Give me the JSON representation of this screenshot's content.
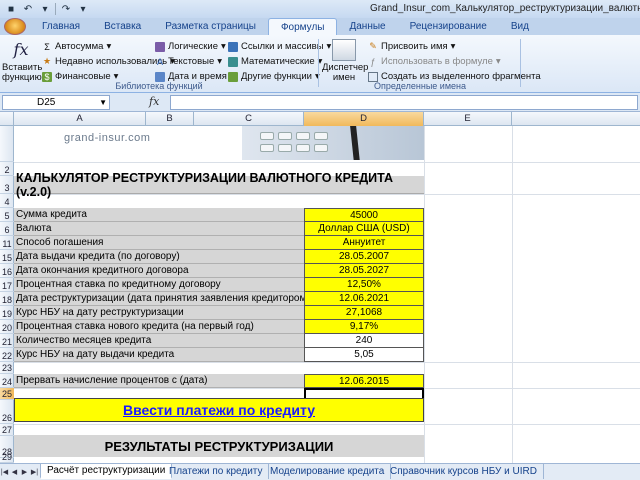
{
  "window": {
    "title": "Grand_Insur_com_Калькулятор_реструктуризации_валютного"
  },
  "ribbon_tabs": [
    "Главная",
    "Вставка",
    "Разметка страницы",
    "Формулы",
    "Данные",
    "Рецензирование",
    "Вид"
  ],
  "active_tab": "Формулы",
  "ribbon": {
    "insert_function": "Вставить функцию",
    "autosum": "Автосумма",
    "recent": "Недавно использовались",
    "financial": "Финансовые",
    "logical": "Логические",
    "text": "Текстовые",
    "datetime": "Дата и время",
    "lookup": "Ссылки и массивы",
    "math": "Математические",
    "other": "Другие функции",
    "library_label": "Библиотека функций",
    "name_manager": "Диспетчер имен",
    "assign_name": "Присвоить имя",
    "use_in_formula": "Использовать в формуле",
    "create_from_sel": "Создать из выделенного фрагмента",
    "names_label": "Определенные имена"
  },
  "formula_bar": {
    "name_box": "D25",
    "fx": "fx",
    "formula": ""
  },
  "columns": [
    "A",
    "B",
    "C",
    "D",
    "E"
  ],
  "rows": [
    "",
    "2",
    "3",
    "4",
    "5",
    "6",
    "11",
    "15",
    "16",
    "17",
    "18",
    "19",
    "20",
    "21",
    "22",
    "23",
    "24",
    "25",
    "26",
    "27",
    "28",
    "29"
  ],
  "sheet": {
    "logo": "grand-insur.com",
    "title": "КАЛЬКУЛЯТОР РЕСТРУКТУРИЗАЦИИ ВАЛЮТНОГО КРЕДИТА (v.2.0)",
    "fields": [
      {
        "label": "Сумма кредита",
        "value": "45000"
      },
      {
        "label": "Валюта",
        "value": "Доллар США (USD)"
      },
      {
        "label": "Способ погашения",
        "value": "Аннуитет"
      },
      {
        "label": "Дата выдачи кредита (по договору)",
        "value": "28.05.2007"
      },
      {
        "label": "Дата окончания кредитного договора",
        "value": "28.05.2027"
      },
      {
        "label": "Процентная ставка по кредитному договору",
        "value": "12,50%"
      },
      {
        "label": "Дата реструктуризации (дата принятия заявления кредитором)",
        "value": "12.06.2021"
      },
      {
        "label": "Курс НБУ на дату реструктуризации",
        "value": "27,1068"
      },
      {
        "label": "Процентная ставка нового кредита (на первый год)",
        "value": "9,17%"
      },
      {
        "label": "Количество месяцев кредита",
        "value": "240"
      },
      {
        "label": "Курс НБУ на дату выдачи кредита",
        "value": "5,05"
      }
    ],
    "interrupt": {
      "label": "Прервать начисление процентов с (дата)",
      "value": "12.06.2015"
    },
    "payments_link": "Ввести платежи по кредиту",
    "results_title": "РЕЗУЛЬТАТЫ РЕСТРУКТУРИЗАЦИИ"
  },
  "sheet_tabs": [
    "Расчёт реструктуризации",
    "Платежи по кредиту",
    "Моделирование кредита",
    "Справочник курсов НБУ и UIRD"
  ],
  "active_sheet": "Расчёт реструктуризации"
}
